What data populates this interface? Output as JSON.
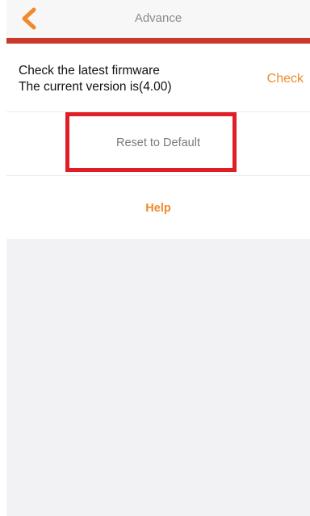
{
  "navbar": {
    "title": "Advance",
    "back_icon": "chevron-left-icon",
    "back_color": "#f08a2c"
  },
  "firmware": {
    "line1": "Check the latest firmware",
    "line2": "The current version is(4.00)",
    "check_label": "Check"
  },
  "reset": {
    "label": "Reset to Default"
  },
  "help": {
    "label": "Help"
  },
  "colors": {
    "accent": "#f08a2c",
    "bar": "#c8392b",
    "highlight": "#e01e26"
  }
}
